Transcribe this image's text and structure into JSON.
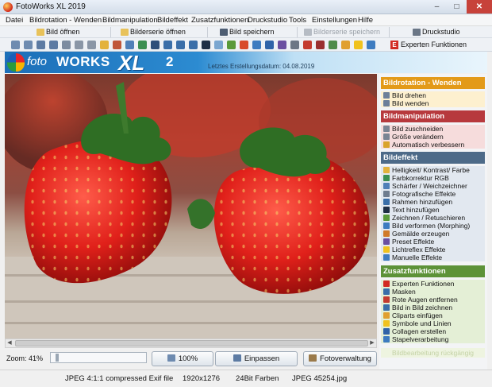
{
  "window": {
    "title": "FotoWorks XL 2019",
    "min": "–",
    "max": "□",
    "close": "✕"
  },
  "menu": [
    "Datei",
    "Bildrotation - Wenden",
    "Bildmanipulation",
    "Bildeffekt",
    "Zusatzfunktionen",
    "Druckstudio",
    "Tools",
    "Einstellungen",
    "Hilfe"
  ],
  "quickbar": {
    "open": "Bild öffnen",
    "series_open": "Bilderserie öffnen",
    "save": "Bild speichern",
    "series_save": "Bilderserie speichern",
    "print": "Druckstudio"
  },
  "iconbar": {
    "expert": "Experten Funktionen",
    "expert_icon": "E",
    "icons": [
      "zoom-out-icon",
      "zoom-in-icon",
      "rotate-left-icon",
      "rotate-right-icon",
      "flip-icon",
      "crop-icon",
      "resize-icon",
      "light-icon",
      "brush-icon",
      "adjust-icon",
      "rgb-icon",
      "print-icon",
      "text-icon",
      "arrow-icon",
      "frame-icon",
      "effect-icon",
      "redeye-icon",
      "gallery-icon",
      "image-icon",
      "batch-icon",
      "pen-icon",
      "collage-icon",
      "palette-icon",
      "star-icon",
      "calendar-icon"
    ]
  },
  "banner": {
    "foto": "foto",
    "works": "WORKS",
    "xl": "XL",
    "version": "2",
    "date_label": "Letztes Erstellungsdatum: 04.08.2019"
  },
  "sidebar": {
    "rotation": {
      "title": "Bildrotation - Wenden",
      "color": "#e39a19",
      "items": [
        "Bild drehen",
        "Bild wenden"
      ]
    },
    "manipulation": {
      "title": "Bildmanipulation",
      "color": "#b7393d",
      "items": [
        "Bild zuschneiden",
        "Größe verändern",
        "Automatisch verbessern"
      ]
    },
    "effects": {
      "title": "Bildeffekt",
      "color": "#4d6a88",
      "items": [
        "Helligkeit/ Kontrast/ Farbe",
        "Farbkorrektur RGB",
        "Schärfer / Weichzeichner",
        "Fotografische Effekte",
        "Rahmen hinzufügen",
        "Text hinzufügen",
        "Zeichnen / Retuschieren",
        "Bild verformen (Morphing)",
        "Gemälde erzeugen",
        "Preset Effekte",
        "Lichtreflex Effekte",
        "Manuelle Effekte"
      ]
    },
    "extras": {
      "title": "Zusatzfunktionen",
      "color": "#5d9238",
      "items": [
        "Experten Funktionen",
        "Masken",
        "Rote Augen entfernen",
        "Bild in Bild zeichnen",
        "Cliparts einfügen",
        "Symbole und Linien",
        "Collagen erstellen",
        "Stapelverarbeitung"
      ]
    },
    "undo": "Bildbearbeitung rückgängig"
  },
  "zoom": {
    "label": "Zoom: 41%",
    "level_fraction": 0.04
  },
  "buttons": {
    "zoom100": "100%",
    "fit": "Einpassen",
    "manager": "Fotoverwaltung"
  },
  "status": {
    "format": "JPEG 4:1:1 compressed Exif file",
    "dimensions": "1920x1276",
    "colors": "24Bit Farben",
    "filename": "JPEG 45254.jpg"
  }
}
